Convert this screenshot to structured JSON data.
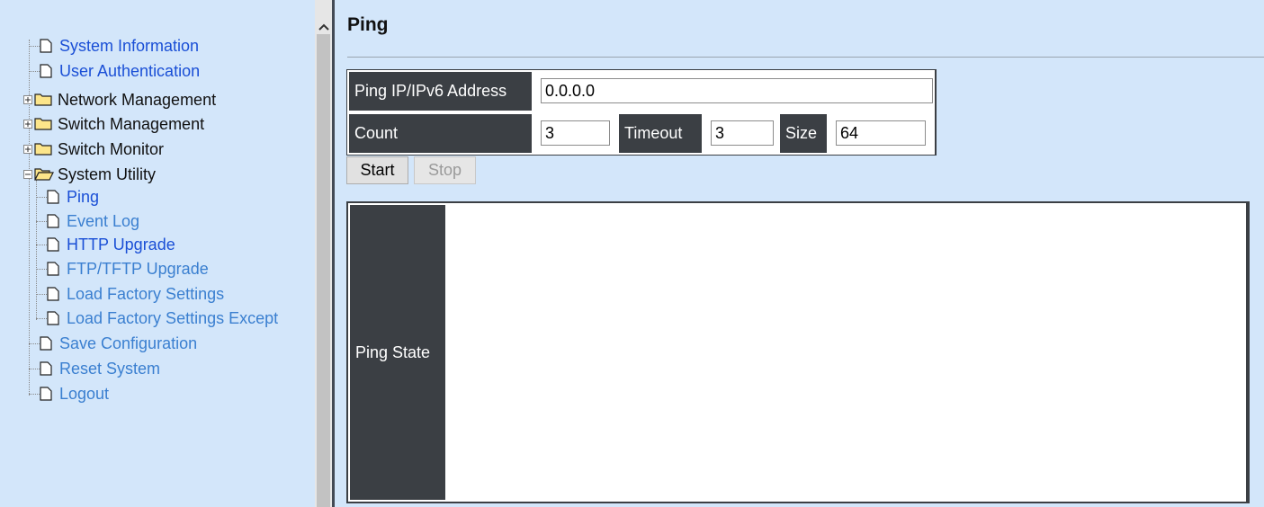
{
  "sidebar": {
    "items": [
      {
        "label": "System Information",
        "type": "doc"
      },
      {
        "label": "User Authentication",
        "type": "doc"
      },
      {
        "label": "Network Management",
        "type": "folder-closed"
      },
      {
        "label": "Switch Management",
        "type": "folder-closed"
      },
      {
        "label": "Switch Monitor",
        "type": "folder-closed"
      },
      {
        "label": "System Utility",
        "type": "folder-open"
      },
      {
        "label": "Ping",
        "type": "doc-child"
      },
      {
        "label": "Event Log",
        "type": "doc-child"
      },
      {
        "label": "HTTP Upgrade",
        "type": "doc-child"
      },
      {
        "label": "FTP/TFTP Upgrade",
        "type": "doc-child"
      },
      {
        "label": "Load Factory Settings",
        "type": "doc-child"
      },
      {
        "label": "Load Factory Settings Except",
        "type": "doc-child"
      },
      {
        "label": "Save Configuration",
        "type": "doc"
      },
      {
        "label": "Reset System",
        "type": "doc"
      },
      {
        "label": "Logout",
        "type": "doc"
      }
    ]
  },
  "main": {
    "title": "Ping",
    "form": {
      "ip_label": "Ping IP/IPv6 Address",
      "ip_value": "0.0.0.0",
      "count_label": "Count",
      "count_value": "3",
      "timeout_label": "Timeout",
      "timeout_value": "3",
      "size_label": "Size",
      "size_value": "64"
    },
    "buttons": {
      "start": "Start",
      "stop": "Stop"
    },
    "state": {
      "label": "Ping State",
      "value": ""
    }
  },
  "colors": {
    "background": "#d3e6fa",
    "header_cell": "#3b3f44",
    "link": "#1a4fd6"
  }
}
